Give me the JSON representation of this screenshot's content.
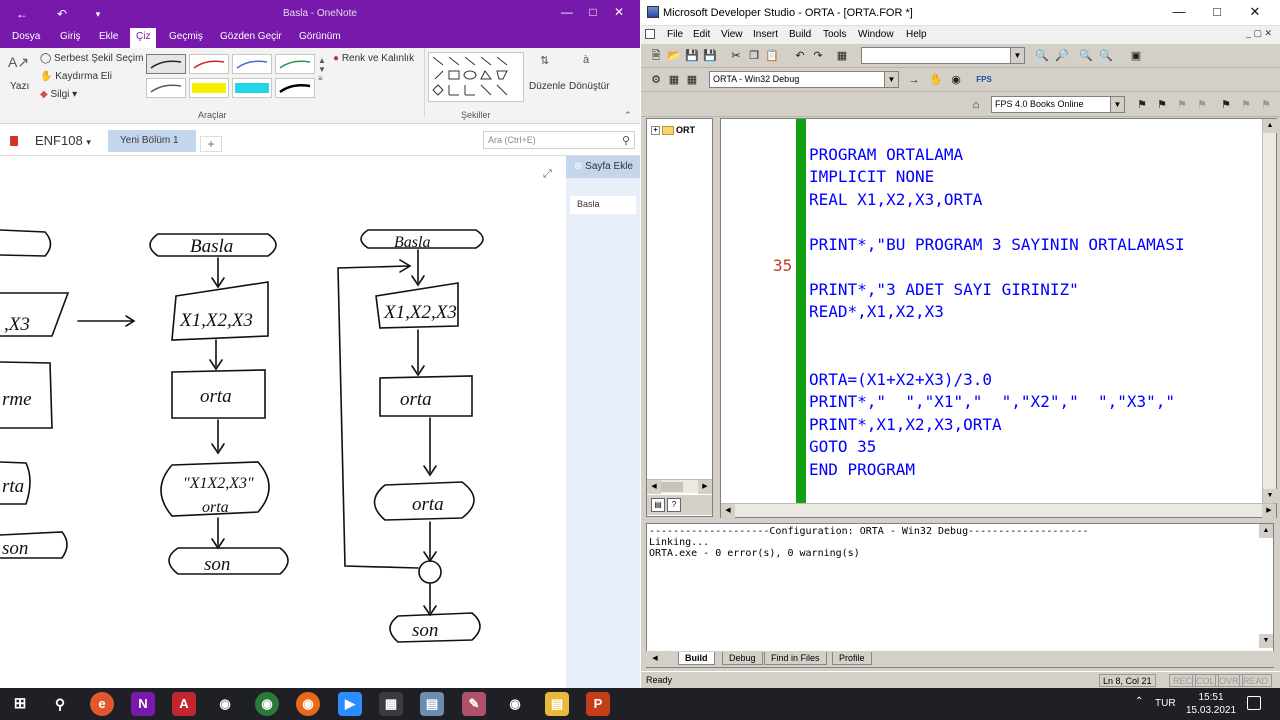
{
  "onenote": {
    "title": "Basla - OneNote",
    "tabs": [
      "Dosya",
      "Giriş",
      "Ekle",
      "Çiz",
      "Geçmiş",
      "Gözden Geçir",
      "Görünüm"
    ],
    "active_tab": "Çiz",
    "ribbon": {
      "type_label": "Yazı",
      "lasso_label": "Serbest Şekil Seçim",
      "panning_label": "Kaydırma Eli",
      "eraser_label": "Silgi",
      "color_thickness_label": "Renk ve Kalınlık",
      "tools_group": "Araçlar",
      "shapes_group": "Şekiller",
      "edit_label": "Düzenle",
      "convert_label": "Dönüştür"
    },
    "notebook_name": "ENF108",
    "section_tab": "Yeni Bölüm 1",
    "add_section": "+",
    "search_placeholder": "Ara (Ctrl+E)",
    "add_page": "Sayfa Ekle",
    "page_item": "Basla",
    "flowchart": {
      "left_partial": [
        ",X3",
        "rme",
        "rta",
        "son"
      ],
      "middle": [
        "Basla",
        "X1,X2,X3",
        "orta",
        "\"X1X2,X3\"",
        "orta",
        "son"
      ],
      "right": [
        "Basla",
        "X1,X2,X3",
        "orta",
        "orta",
        "son"
      ]
    }
  },
  "devstudio": {
    "title": "Microsoft Developer Studio - ORTA - [ORTA.FOR *]",
    "menus": [
      "File",
      "Edit",
      "View",
      "Insert",
      "Build",
      "Tools",
      "Window",
      "Help"
    ],
    "config_combo": "ORTA - Win32 Debug",
    "books_combo": "FPS 4.0 Books Online",
    "tree_item": "ORT",
    "code_lines": [
      "PROGRAM ORTALAMA",
      "IMPLICIT NONE",
      "REAL X1,X2,X3,ORTA",
      "",
      "PRINT*,\"BU PROGRAM 3 SAYININ ORTALAMASI",
      "",
      "PRINT*,\"3 ADET SAYI GIRINIZ\"",
      "READ*,X1,X2,X3",
      "",
      "",
      "ORTA=(X1+X2+X3)/3.0",
      "PRINT*,\"  \",\"X1\",\"  \",\"X2\",\"  \",\"X3\",\"",
      "PRINT*,X1,X2,X3,ORTA",
      "GOTO 35",
      "END PROGRAM"
    ],
    "line_label": "35",
    "output_lines": [
      "--------------------Configuration: ORTA - Win32 Debug--------------------",
      "Linking...",
      "ORTA.exe - 0 error(s), 0 warning(s)"
    ],
    "output_tabs": [
      "Build",
      "Debug",
      "Find in Files",
      "Profile"
    ],
    "status": {
      "ready": "Ready",
      "position": "Ln 8, Col 21",
      "rec": "REC",
      "col": "COL",
      "ovr": "OVR",
      "read": "READ"
    }
  },
  "taskbar": {
    "lang": "TUR",
    "time": "15:51",
    "date": "15.03.2021"
  }
}
